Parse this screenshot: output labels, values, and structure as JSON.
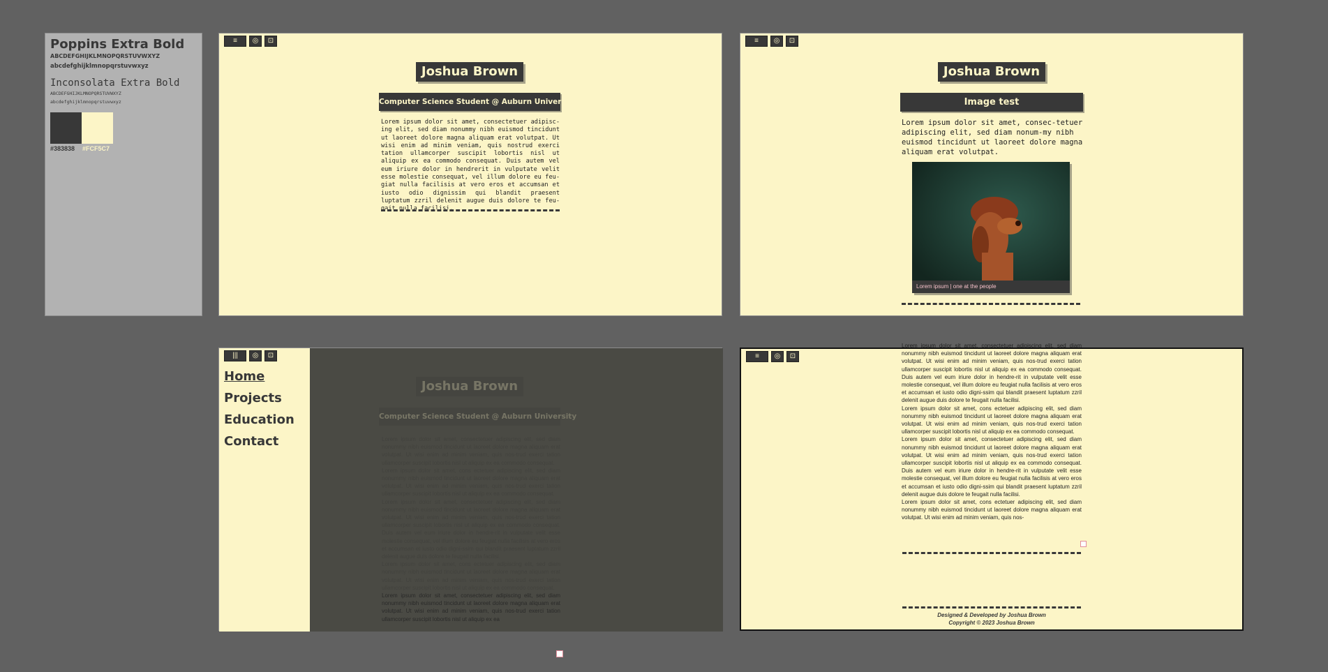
{
  "style_guide": {
    "font1_name": "Poppins Extra Bold",
    "font1_upper": "ABCDEFGHIJKLMNOPQRSTUVWXYZ",
    "font1_lower": "abcdefghijklmnopqrstuvwxyz",
    "font2_name": "Inconsolata Extra Bold",
    "font2_upper": "ABCDEFGHIJKLMNOPQRSTUVWXYZ",
    "font2_lower": "abcdefghijklmnopqrstuvwxyz",
    "color1": "#383838",
    "color2": "#FCF5C7",
    "color1_label": "#383838",
    "color2_label": "#FCF5C7"
  },
  "toolbar": {
    "menu_icon": "≡",
    "menu_open_icon": "|||",
    "target_icon": "◎",
    "download_icon": "⊡"
  },
  "frame1": {
    "name": "Joshua Brown",
    "subtitle": "Computer Science Student @ Auburn University",
    "body": "Lorem ipsum dolor sit amet, consectetuer adipisc-ing elit, sed diam nonummy nibh euismod tincidunt ut laoreet dolore magna aliquam erat volutpat. Ut wisi enim ad minim veniam, quis nostrud exerci tation ullamcorper suscipit lobortis nisl ut aliquip ex ea commodo consequat. Duis autem vel eum iriure dolor in hendrerit in vulputate velit esse molestie consequat, vel illum dolore eu feu-giat nulla facilisis at vero eros et accumsan et iusto odio dignissim qui blandit praesent luptatum zzril delenit augue duis dolore te feu-gait nulla facilisi."
  },
  "frame2": {
    "name": "Joshua Brown",
    "subtitle": "Image test",
    "body": "Lorem ipsum dolor sit amet, consec-tetuer adipiscing elit, sed diam nonum-my nibh euismod tincidunt ut laoreet dolore magna aliquam erat volutpat.",
    "caption": "Lorem ipsum | one at the people"
  },
  "frame3": {
    "nav": [
      "Home",
      "Projects",
      "Education",
      "Contact"
    ],
    "name": "Joshua Brown",
    "subtitle": "Computer Science Student @ Auburn University",
    "paras": [
      "Lorem ipsum dolor sit amet, consectetuer adipiscing elit, sed diam nonummy nibh euismod tincidunt ut laoreet dolore magna aliquam erat volutpat. Ut wisi enim ad minim veniam, quis nos-trud exerci tation ullamcorper suscipit lobortis nisl ut aliquip ex ea commodo consequat.",
      "Lorem ipsum dolor sit amet, cons ectetuer adipiscing elit, sed diam nonummy nibh euismod tincidunt ut laoreet dolore magna aliquam erat volutpat. Ut wisi enim ad minim veniam, quis nos-trud exerci tation ullamcorper suscipit lobortis nisl ut aliquip ex ea commodo consequat.",
      "Lorem ipsum dolor sit amet, consectetuer adipiscing elit, sed diam nonummy nibh euismod tincidunt ut laoreet dolore magna aliquam erat volutpat. Ut wisi enim ad minim veniam, quis nos-trud exerci tation ullamcorper suscipit lobortis nisl ut aliquip ex ea commodo consequat. Duis autem vel eum iriure dolor in hendre-rit in vulputate velit esse molestie consequat, vel illum dolore eu feugiat nulla facilisis at vero eros et accumsan et iusto odio digni-ssim qui blandit praesent luptatum zzril delenit augue duis dolore te feugait nulla facilisi.",
      "Lorem ipsum dolor sit amet, cons ectetuer adipiscing elit, sed diam nonummy nibh euismod tincidunt ut laoreet dolore magna aliquam erat volutpat. Ut wisi enim ad minim veniam, quis nos-trud exerci tation ullamcorper suscipit lobortis nisl ut aliquip ex ea commodo consequat.",
      "Lorem ipsum dolor sit amet, consectetuer adipiscing elit, sed diam nonummy nibh euismod tincidunt ut laoreet dolore magna aliquam erat volutpat. Ut wisi enim ad minim veniam, quis nos-trud exerci tation ullamcorper suscipit lobortis nisl ut aliquip ex ea"
    ]
  },
  "frame4": {
    "paras": [
      "Lorem ipsum dolor sit amet, consectetuer adipiscing elit, sed diam nonummy nibh euismod tincidunt ut laoreet dolore magna aliquam erat volutpat. Ut wisi enim ad minim veniam, quis nos-trud exerci tation ullamcorper suscipit lobortis nisl ut aliquip ex ea commodo consequat. Duis autem vel eum iriure dolor in hendre-rit in vulputate velit esse molestie consequat, vel illum dolore eu feugiat nulla facilisis at vero eros et accumsan et iusto odio digni-ssim qui blandit praesent luptatum zzril delenit augue duis dolore te feugait nulla facilisi.",
      "Lorem ipsum dolor sit amet, cons ectetuer adipiscing elit, sed diam nonummy nibh euismod tincidunt ut laoreet dolore magna aliquam erat volutpat. Ut wisi enim ad minim veniam, quis nos-trud exerci tation ullamcorper suscipit lobortis nisl ut aliquip ex ea commodo consequat.",
      "Lorem ipsum dolor sit amet, consectetuer adipiscing elit, sed diam nonummy nibh euismod tincidunt ut laoreet dolore magna aliquam erat volutpat. Ut wisi enim ad minim veniam, quis nos-trud exerci tation ullamcorper suscipit lobortis nisl ut aliquip ex ea commodo consequat. Duis autem vel eum iriure dolor in hendre-rit in vulputate velit esse molestie consequat, vel illum dolore eu feugiat nulla facilisis at vero eros et accumsan et iusto odio digni-ssim qui blandit praesent luptatum zzril delenit augue duis dolore te feugait nulla facilisi.",
      "Lorem ipsum dolor sit amet, cons ectetuer adipiscing elit, sed diam nonummy nibh euismod tincidunt ut laoreet dolore magna aliquam erat volutpat. Ut wisi enim ad minim veniam, quis nos-"
    ],
    "footer_line1": "Designed & Developed by Joshua Brown",
    "footer_line2": "Copyright © 2023 Joshua Brown"
  }
}
